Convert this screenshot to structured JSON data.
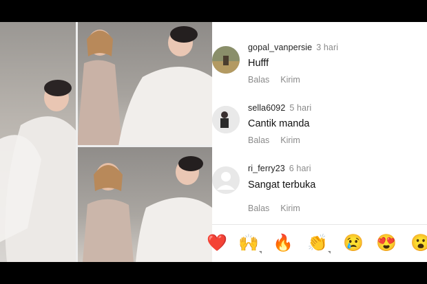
{
  "comments": [
    {
      "username": "gopal_vanpersie",
      "time": "3 hari",
      "text": "Hufff",
      "reply": "Balas",
      "send": "Kirim"
    },
    {
      "username": "sella6092",
      "time": "5 hari",
      "text": "Cantik manda",
      "reply": "Balas",
      "send": "Kirim"
    },
    {
      "username": "ri_ferry23",
      "time": "6 hari",
      "text": "Sangat terbuka",
      "reply": "Balas",
      "send": "Kirim"
    }
  ],
  "reactions": [
    "❤️",
    "🙌",
    "🔥",
    "👏",
    "😢",
    "😍",
    "😮"
  ],
  "colors": {
    "meta": "#8a8a8a",
    "text": "#111111",
    "background": "#ffffff"
  }
}
